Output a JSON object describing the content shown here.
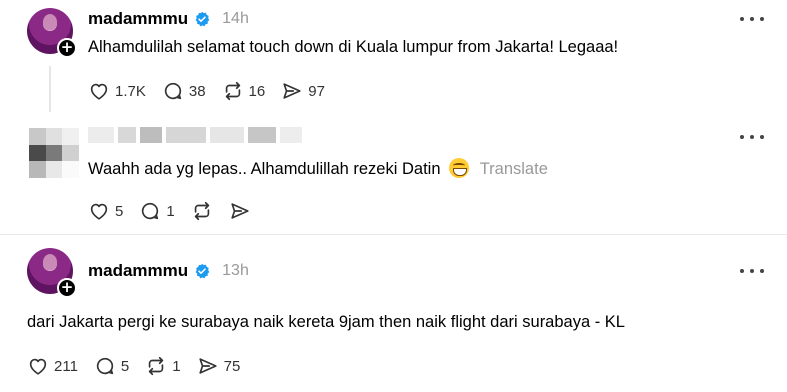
{
  "posts": [
    {
      "username": "madammmu",
      "time": "14h",
      "text": "Alhamdulilah selamat touch down di Kuala lumpur from Jakarta! Legaaa!",
      "likes": "1.7K",
      "comments": "38",
      "reposts": "16",
      "shares": "97"
    },
    {
      "username": "",
      "text": "Waahh ada yg lepas.. Alhamdulillah rezeki Datin",
      "translate": "Translate",
      "likes": "5",
      "comments": "1",
      "reposts": "",
      "shares": ""
    },
    {
      "username": "madammmu",
      "time": "13h",
      "text": "dari Jakarta pergi ke surabaya naik kereta 9jam then naik flight dari surabaya - KL",
      "likes": "211",
      "comments": "5",
      "reposts": "1",
      "shares": "75"
    }
  ],
  "colors": {
    "verified_blue": "#1d9bf0",
    "muted_gray": "#999999",
    "icon_dark": "#333333"
  },
  "icons": [
    "heart-icon",
    "comment-icon",
    "repost-icon",
    "share-icon",
    "more-icon",
    "verified-icon",
    "follow-plus-icon",
    "grin-emoji-icon"
  ]
}
